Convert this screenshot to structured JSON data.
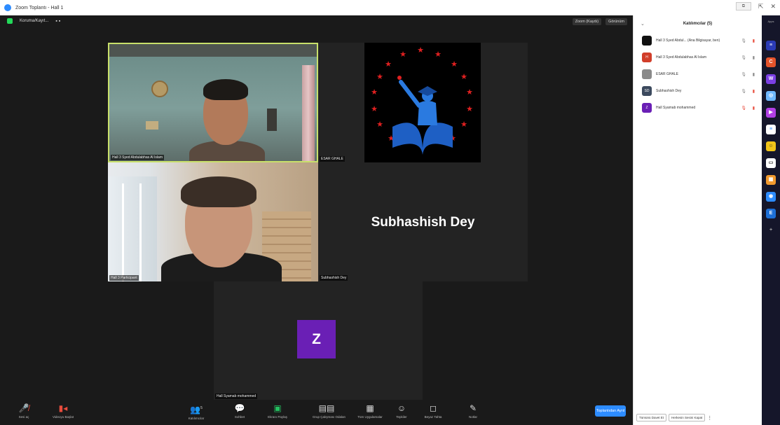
{
  "window": {
    "title": "Zoom Toplantı - Hall 1"
  },
  "meeting": {
    "view_info": "Koruma/Kayıt...",
    "top_right_pill_1": "Zoom (Kaydı)",
    "top_right_pill_2": "Görünüm",
    "tiles": [
      {
        "name": "Hall 3 Syed Abdulabhas Al Islam"
      },
      {
        "name": "ESAR GHALE"
      },
      {
        "name": "Hall 3 Participant"
      },
      {
        "name": "Subhashish Dey",
        "big_name": "Subhashish Dey"
      },
      {
        "name": "Hall Syamab mohammed",
        "avatar_letter": "Z"
      }
    ]
  },
  "toolbar": {
    "items": [
      {
        "icon": "microphone-icon",
        "label": "Sesi aç"
      },
      {
        "icon": "video-icon",
        "label": "Videoyu Başlat"
      },
      {
        "icon": "participants-icon",
        "label": "Katılımcılar",
        "count": "5"
      },
      {
        "icon": "chat-icon",
        "label": "Sohbet"
      },
      {
        "icon": "share-screen-icon",
        "label": "Ekranı Paylaş"
      },
      {
        "icon": "breakout-rooms-icon",
        "label": "Grup Çalışması Odaları"
      },
      {
        "icon": "apps-icon",
        "label": "Tüm Uygulamalar"
      },
      {
        "icon": "reactions-icon",
        "label": "Tepkiler"
      },
      {
        "icon": "whiteboard-icon",
        "label": "Beyaz Tahta"
      },
      {
        "icon": "notes-icon",
        "label": "Notlar"
      }
    ],
    "end_label": "Toplantıdan Ayrıl"
  },
  "panel": {
    "title": "Katılımcılar (5)",
    "participants": [
      {
        "initials": "",
        "name": "Hall 3 Syed Abdul... (Ana Bilgisayar, ben)",
        "color": "#111111"
      },
      {
        "initials": "H",
        "name": "Hall 3 Syed Abdulabhas Al Islam",
        "color": "#d13e2a"
      },
      {
        "initials": "",
        "name": "ESAR GHALE",
        "color": "#8a8a8a"
      },
      {
        "initials": "SD",
        "name": "Subhashish Dey",
        "color": "#3c4a5e"
      },
      {
        "initials": "Z",
        "name": "Hall Syamab mohammed",
        "color": "#6a1fb5"
      }
    ],
    "footer_btn_1": "Tümünü Davet Et",
    "footer_btn_2": "Herkesin Sesini Kapat"
  },
  "appstrip": {
    "label": "Apps"
  }
}
